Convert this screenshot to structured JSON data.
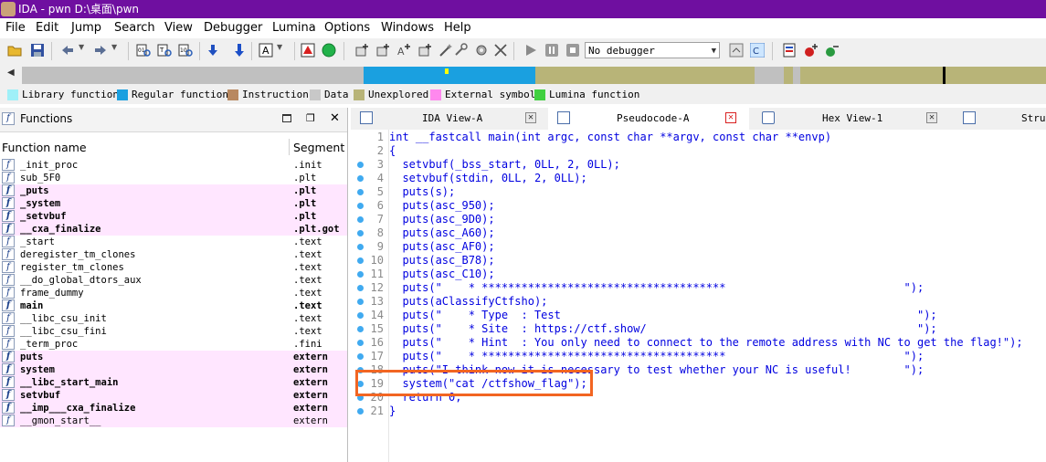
{
  "title": "IDA - pwn D:\\桌面\\pwn",
  "menu": [
    "File",
    "Edit",
    "Jump",
    "Search",
    "View",
    "Debugger",
    "Lumina",
    "Options",
    "Windows",
    "Help"
  ],
  "debugger_select": "No debugger",
  "legend": [
    {
      "label": "Library function",
      "color": "#9ff0f8"
    },
    {
      "label": "Regular function",
      "color": "#1aa0e0"
    },
    {
      "label": "Instruction",
      "color": "#b88860"
    },
    {
      "label": "Data",
      "color": "#c8c8c8"
    },
    {
      "label": "Unexplored",
      "color": "#b8b478"
    },
    {
      "label": "External symbol",
      "color": "#ff88ee"
    },
    {
      "label": "Lumina function",
      "color": "#40d040"
    }
  ],
  "functions_panel": {
    "title": "Functions",
    "col_name": "Function name",
    "col_segment": "Segment",
    "rows": [
      {
        "name": "_init_proc",
        "seg": ".init",
        "hl": false,
        "bold": false
      },
      {
        "name": "sub_5F0",
        "seg": ".plt",
        "hl": false,
        "bold": false
      },
      {
        "name": "_puts",
        "seg": ".plt",
        "hl": true,
        "bold": true
      },
      {
        "name": "_system",
        "seg": ".plt",
        "hl": true,
        "bold": true
      },
      {
        "name": "_setvbuf",
        "seg": ".plt",
        "hl": true,
        "bold": true
      },
      {
        "name": "__cxa_finalize",
        "seg": ".plt.got",
        "hl": true,
        "bold": true
      },
      {
        "name": "_start",
        "seg": ".text",
        "hl": false,
        "bold": false
      },
      {
        "name": "deregister_tm_clones",
        "seg": ".text",
        "hl": false,
        "bold": false
      },
      {
        "name": "register_tm_clones",
        "seg": ".text",
        "hl": false,
        "bold": false
      },
      {
        "name": "__do_global_dtors_aux",
        "seg": ".text",
        "hl": false,
        "bold": false
      },
      {
        "name": "frame_dummy",
        "seg": ".text",
        "hl": false,
        "bold": false
      },
      {
        "name": "main",
        "seg": ".text",
        "hl": false,
        "bold": true
      },
      {
        "name": "__libc_csu_init",
        "seg": ".text",
        "hl": false,
        "bold": false
      },
      {
        "name": "__libc_csu_fini",
        "seg": ".text",
        "hl": false,
        "bold": false
      },
      {
        "name": "_term_proc",
        "seg": ".fini",
        "hl": false,
        "bold": false
      },
      {
        "name": "puts",
        "seg": "extern",
        "hl": true,
        "bold": true
      },
      {
        "name": "system",
        "seg": "extern",
        "hl": true,
        "bold": true
      },
      {
        "name": "__libc_start_main",
        "seg": "extern",
        "hl": true,
        "bold": true
      },
      {
        "name": "setvbuf",
        "seg": "extern",
        "hl": true,
        "bold": true
      },
      {
        "name": "__imp___cxa_finalize",
        "seg": "extern",
        "hl": true,
        "bold": true
      },
      {
        "name": "__gmon_start__",
        "seg": "extern",
        "hl": true,
        "bold": false
      }
    ]
  },
  "tabs": [
    {
      "label": "IDA View-A",
      "active": false
    },
    {
      "label": "Pseudocode-A",
      "active": true
    },
    {
      "label": "Hex View-1",
      "active": false
    },
    {
      "label": "Stru",
      "active": false
    }
  ],
  "code_lines": [
    {
      "n": "1",
      "dot": false,
      "text": "int __fastcall main(int argc, const char **argv, const char **envp)"
    },
    {
      "n": "2",
      "dot": false,
      "text": "{"
    },
    {
      "n": "3",
      "dot": true,
      "text": "  setvbuf(_bss_start, 0LL, 2, 0LL);"
    },
    {
      "n": "4",
      "dot": true,
      "text": "  setvbuf(stdin, 0LL, 2, 0LL);"
    },
    {
      "n": "5",
      "dot": true,
      "text": "  puts(s);"
    },
    {
      "n": "6",
      "dot": true,
      "text": "  puts(asc_950);"
    },
    {
      "n": "7",
      "dot": true,
      "text": "  puts(asc_9D0);"
    },
    {
      "n": "8",
      "dot": true,
      "text": "  puts(asc_A60);"
    },
    {
      "n": "9",
      "dot": true,
      "text": "  puts(asc_AF0);"
    },
    {
      "n": "10",
      "dot": true,
      "text": "  puts(asc_B78);"
    },
    {
      "n": "11",
      "dot": true,
      "text": "  puts(asc_C10);"
    },
    {
      "n": "12",
      "dot": true,
      "text": "  puts(\"    * *************************************                           \");"
    },
    {
      "n": "13",
      "dot": true,
      "text": "  puts(aClassifyCtfsho);"
    },
    {
      "n": "14",
      "dot": true,
      "text": "  puts(\"    * Type  : Test                                                      \");"
    },
    {
      "n": "15",
      "dot": true,
      "text": "  puts(\"    * Site  : https://ctf.show/                                         \");"
    },
    {
      "n": "16",
      "dot": true,
      "text": "  puts(\"    * Hint  : You only need to connect to the remote address with NC to get the flag!\");"
    },
    {
      "n": "17",
      "dot": true,
      "text": "  puts(\"    * *************************************                           \");"
    },
    {
      "n": "18",
      "dot": true,
      "text": "  puts(\"I think now it is necessary to test whether your NC is useful!        \");"
    },
    {
      "n": "19",
      "dot": true,
      "text": "  system(\"cat /ctfshow_flag\");"
    },
    {
      "n": "20",
      "dot": true,
      "text": "  return 0;"
    },
    {
      "n": "21",
      "dot": true,
      "text": "}"
    }
  ]
}
